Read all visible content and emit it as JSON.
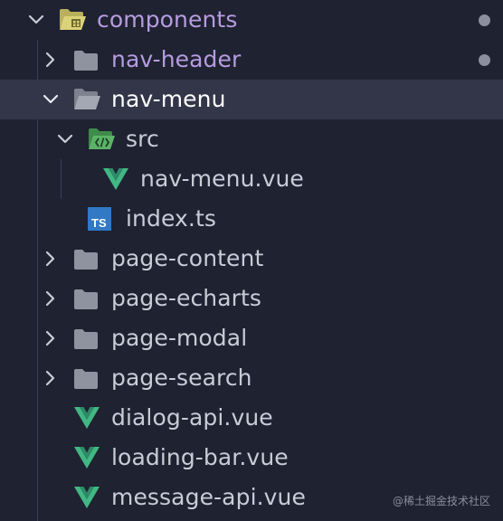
{
  "colors": {
    "background": "#1f2231",
    "selected_row": "#323648",
    "modified_text": "#b69ce0",
    "vue_green": "#41b883",
    "ts_blue": "#3178c6"
  },
  "tree": {
    "components": {
      "label": "components",
      "icon": "folder-open-icon",
      "expanded": true,
      "modified": true
    },
    "nav_header": {
      "label": "nav-header",
      "icon": "folder-icon",
      "expanded": false,
      "modified": true
    },
    "nav_menu": {
      "label": "nav-menu",
      "icon": "folder-open-icon",
      "expanded": true,
      "selected": true
    },
    "src": {
      "label": "src",
      "icon": "source-folder-icon",
      "expanded": true
    },
    "nav_menu_vue": {
      "label": "nav-menu.vue",
      "icon": "vue-icon"
    },
    "index_ts": {
      "label": "index.ts",
      "icon": "typescript-icon",
      "badge": "TS"
    },
    "page_content": {
      "label": "page-content",
      "icon": "folder-icon",
      "expanded": false
    },
    "page_echarts": {
      "label": "page-echarts",
      "icon": "folder-icon",
      "expanded": false
    },
    "page_modal": {
      "label": "page-modal",
      "icon": "folder-icon",
      "expanded": false
    },
    "page_search": {
      "label": "page-search",
      "icon": "folder-icon",
      "expanded": false
    },
    "dialog_api_vue": {
      "label": "dialog-api.vue",
      "icon": "vue-icon"
    },
    "loading_bar_vue": {
      "label": "loading-bar.vue",
      "icon": "vue-icon"
    },
    "message_api_vue": {
      "label": "message-api.vue",
      "icon": "vue-icon"
    }
  },
  "watermark": "@稀土掘金技术社区"
}
